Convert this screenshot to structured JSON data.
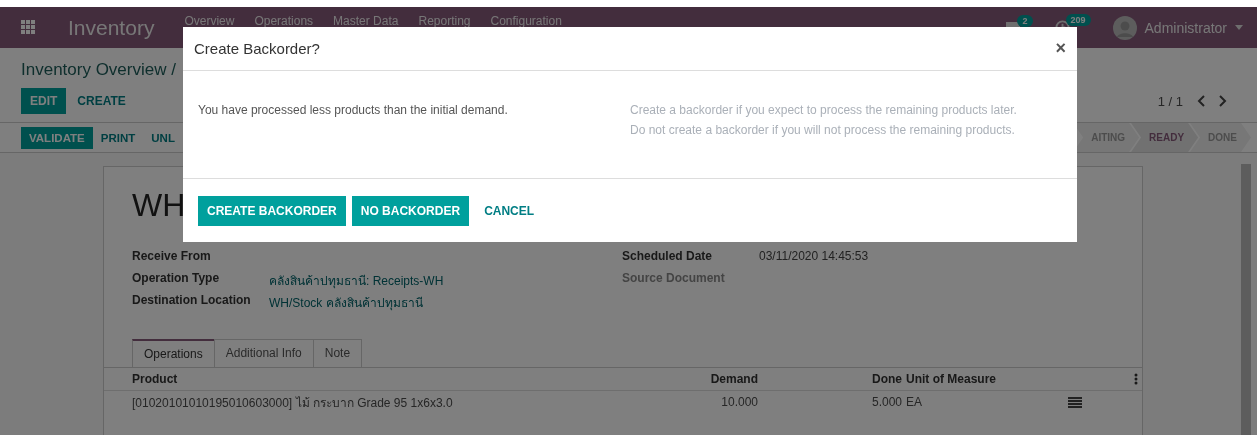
{
  "navbar": {
    "app_title": "Inventory",
    "menu": [
      "Overview",
      "Operations",
      "Master Data",
      "Reporting",
      "Configuration"
    ],
    "messages_badge": "2",
    "activities_badge": "209",
    "user": "Administrator"
  },
  "breadcrumb": "Inventory Overview /",
  "actions": [
    {
      "label": "EDIT",
      "kind": "primary"
    },
    {
      "label": "CREATE",
      "kind": "link"
    }
  ],
  "pager": "1 / 1",
  "header_buttons": [
    {
      "label": "VALIDATE",
      "kind": "primary"
    },
    {
      "label": "PRINT",
      "kind": "link"
    },
    {
      "label": "UNL",
      "kind": "link"
    }
  ],
  "status_steps": [
    {
      "label": "AITING",
      "selected": false
    },
    {
      "label": "READY",
      "selected": true
    },
    {
      "label": "DONE",
      "selected": false
    }
  ],
  "record": {
    "title": "WH",
    "left_fields": [
      {
        "label": "Receive From",
        "disabled": false
      },
      {
        "label": "Operation Type",
        "value": "คลังสินค้าปทุมธานี: Receipts-WH",
        "disabled": false
      },
      {
        "label": "Destination Location",
        "value": "WH/Stock คลังสินค้าปทุมธานี",
        "disabled": false
      }
    ],
    "right_fields": [
      {
        "label": "Scheduled Date",
        "value": "03/11/2020 14:45:53",
        "disabled": false
      },
      {
        "label": "Source Document",
        "disabled": true
      }
    ],
    "tabs": [
      {
        "label": "Operations",
        "selected": true
      },
      {
        "label": "Additional Info",
        "selected": false
      },
      {
        "label": "Note",
        "selected": false
      }
    ],
    "columns": [
      "Product",
      "Demand",
      "Done",
      "Unit of Measure"
    ],
    "rows": [
      {
        "product": "[01020101010195010603000] ไม้ กระบาก Grade 95 1x6x3.0",
        "demand": "10.000",
        "done": "5.000",
        "uom": "EA"
      }
    ]
  },
  "dialog": {
    "title": "Create Backorder?",
    "close": "×",
    "message": "You have processed less products than the initial demand.",
    "hints": [
      "Create a backorder if you expect to process the remaining products later.",
      "Do not create a backorder if you will not process the remaining products."
    ],
    "buttons": [
      {
        "label": "CREATE BACKORDER",
        "kind": "primary"
      },
      {
        "label": "NO BACKORDER",
        "kind": "primary"
      },
      {
        "label": "CANCEL",
        "kind": "link"
      }
    ]
  }
}
